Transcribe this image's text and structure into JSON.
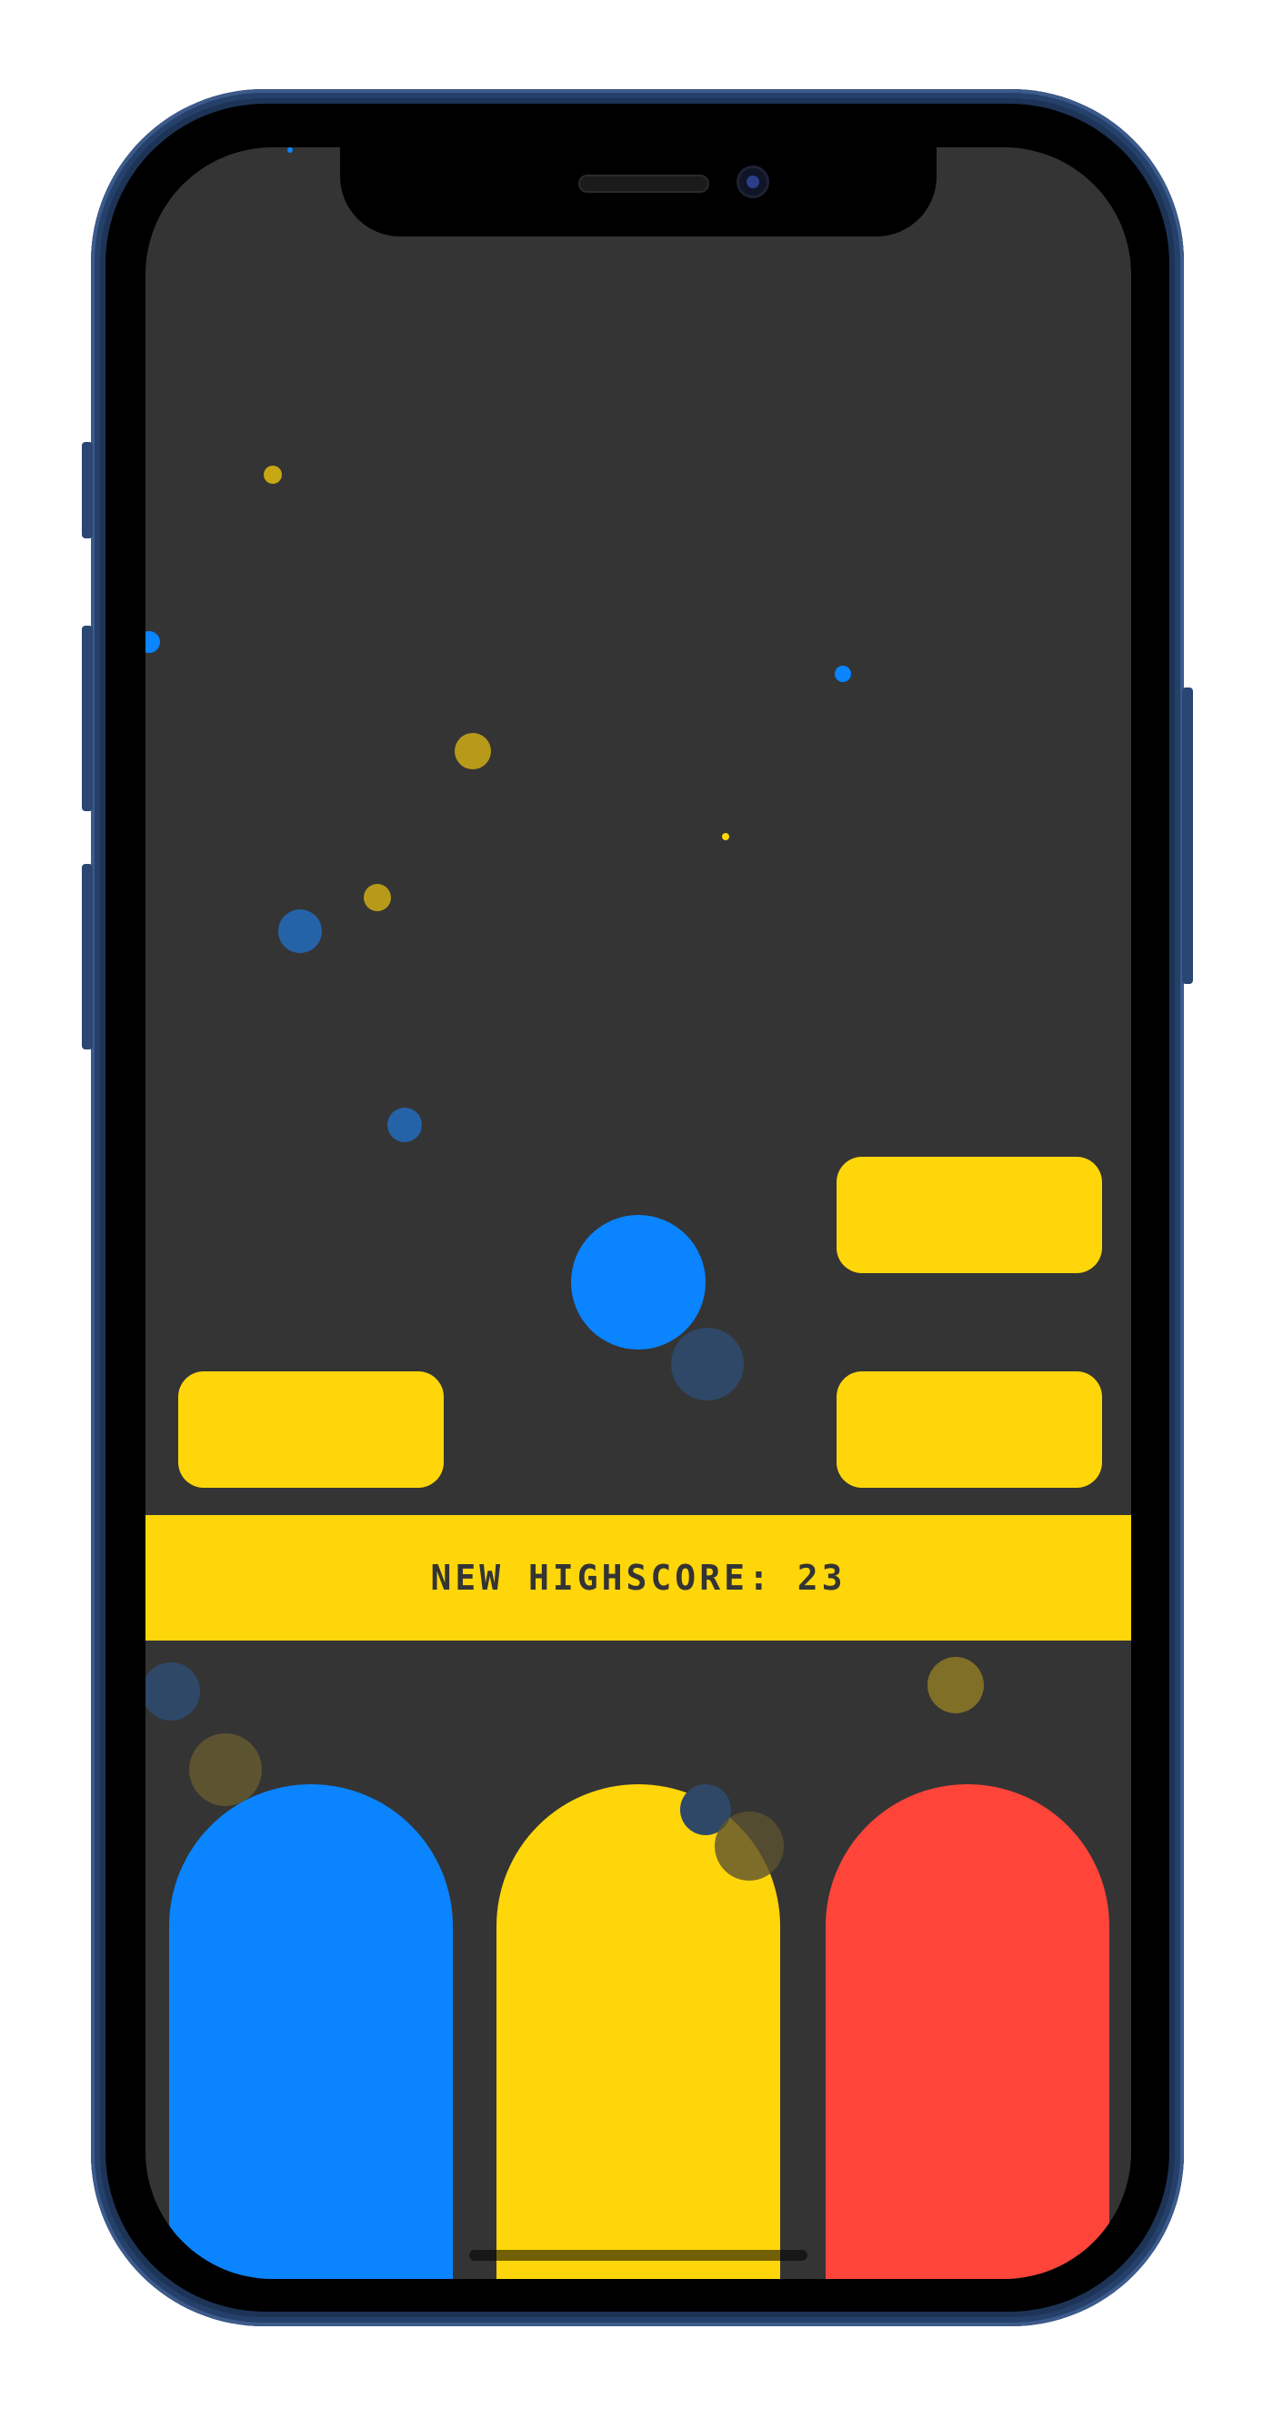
{
  "game": {
    "banner_text": "NEW HIGHSCORE: 23",
    "colors": {
      "background": "#343434",
      "blue": "#0a84ff",
      "yellow": "#ffd60a",
      "red": "#ff453a"
    }
  },
  "controls": [
    {
      "color_name": "blue",
      "color": "#0a84ff"
    },
    {
      "color_name": "yellow",
      "color": "#ffd60a"
    },
    {
      "color_name": "red",
      "color": "#ff453a"
    }
  ],
  "player": {
    "color_name": "blue",
    "color": "#0a84ff"
  },
  "platforms": [
    {
      "color_name": "yellow"
    },
    {
      "color_name": "yellow"
    },
    {
      "color_name": "yellow"
    }
  ]
}
